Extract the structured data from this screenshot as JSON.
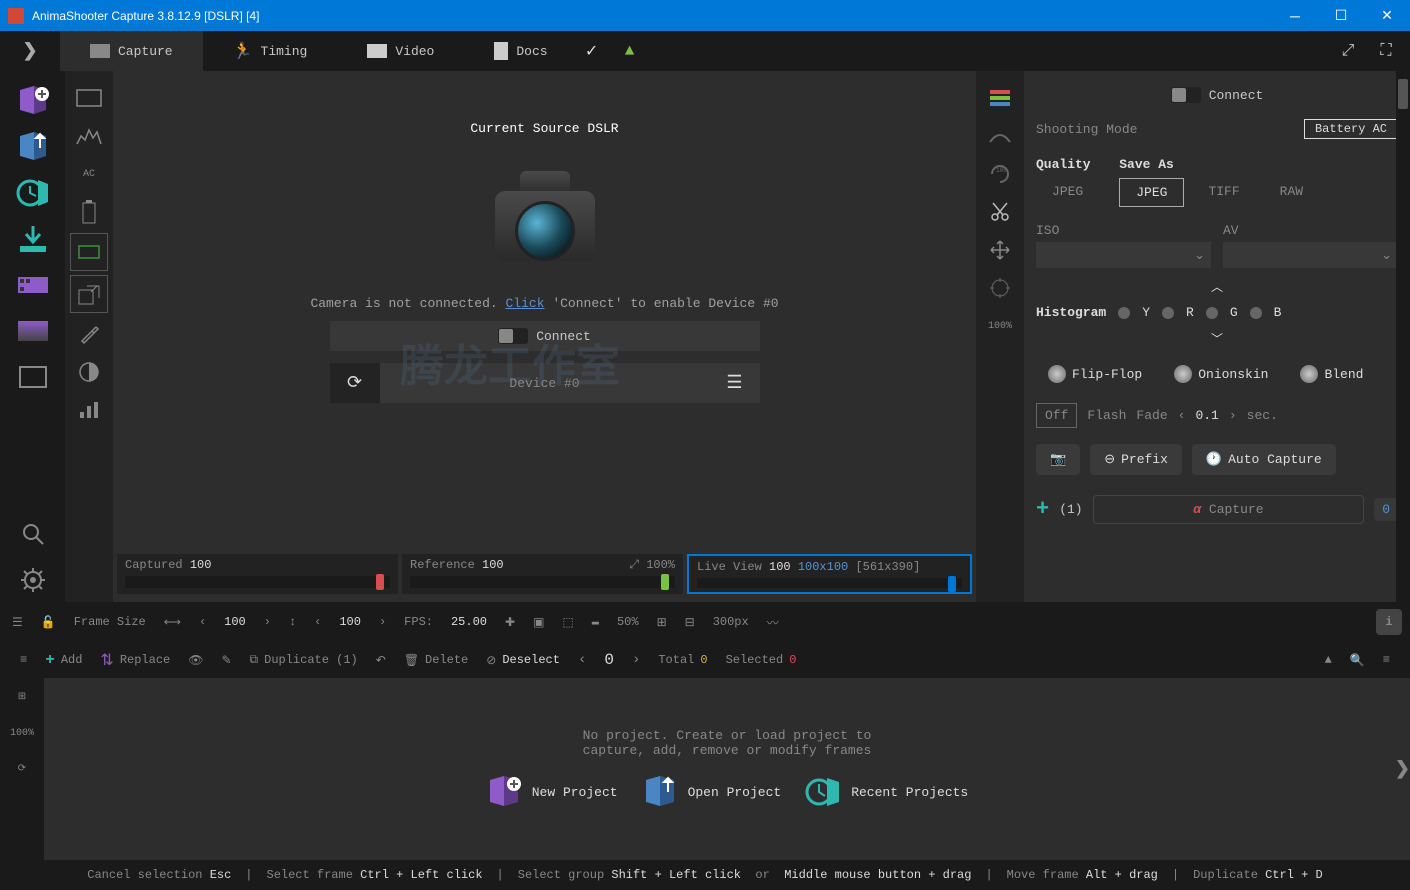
{
  "titlebar": {
    "title": "AnimaShooter Capture 3.8.12.9 [DSLR] [4]"
  },
  "tabs": {
    "capture": "Capture",
    "timing": "Timing",
    "video": "Video",
    "docs": "Docs"
  },
  "preview": {
    "source_label": "Current Source",
    "source_value": "DSLR",
    "not_connected": "Camera is not connected.",
    "click": "Click",
    "connect_hint": "'Connect' to enable Device #0",
    "connect": "Connect",
    "device": "Device #0"
  },
  "sliders": {
    "captured": "Captured",
    "captured_val": "100",
    "reference": "Reference",
    "reference_val": "100",
    "ref_pct": "100%",
    "live": "Live View",
    "live_val": "100",
    "live_dim": "100x100",
    "live_px": "[561x390]"
  },
  "toolbar": {
    "frame_size": "Frame Size",
    "frame_w": "100",
    "frame_h": "100",
    "fps_label": "FPS:",
    "fps_val": "25.00",
    "zoom": "50%",
    "grid": "300px"
  },
  "editbar": {
    "add": "Add",
    "replace": "Replace",
    "duplicate": "Duplicate (1)",
    "delete": "Delete",
    "deselect": "Deselect",
    "counter": "0",
    "total_label": "Total",
    "total_val": "0",
    "selected_label": "Selected",
    "selected_val": "0"
  },
  "timeline": {
    "msg1": "No project. Create or load project to",
    "msg2": "capture, add, remove or modify frames",
    "new": "New Project",
    "open": "Open Project",
    "recent": "Recent Projects",
    "left_pct": "100%"
  },
  "right": {
    "connect": "Connect",
    "shooting_mode": "Shooting Mode",
    "battery": "Battery AC",
    "quality": "Quality",
    "save_as": "Save As",
    "jpeg": "JPEG",
    "tiff": "TIFF",
    "raw": "RAW",
    "iso": "ISO",
    "av": "AV",
    "histogram": "Histogram",
    "h_y": "Y",
    "h_r": "R",
    "h_g": "G",
    "h_b": "B",
    "flipflop": "Flip-Flop",
    "onion": "Onionskin",
    "blend": "Blend",
    "off": "Off",
    "flash": "Flash",
    "fade": "Fade",
    "fade_val": "0.1",
    "sec": "sec.",
    "prefix": "Prefix",
    "auto_cap": "Auto Capture",
    "plus_count": "(1)",
    "capture": "Capture",
    "badge": "0",
    "tool_100": "100%"
  },
  "status": {
    "cancel_l": "Cancel selection",
    "cancel_c": "Esc",
    "sel_frame_l": "Select frame",
    "sel_frame_c": "Ctrl + Left click",
    "sel_group_l": "Select group",
    "sel_group_c": "Shift + Left click",
    "or": "or",
    "mid": "Middle mouse button + drag",
    "move_l": "Move frame",
    "move_c": "Alt + drag",
    "dup_l": "Duplicate",
    "dup_c": "Ctrl + D"
  },
  "inner": {
    "ac": "AC"
  }
}
